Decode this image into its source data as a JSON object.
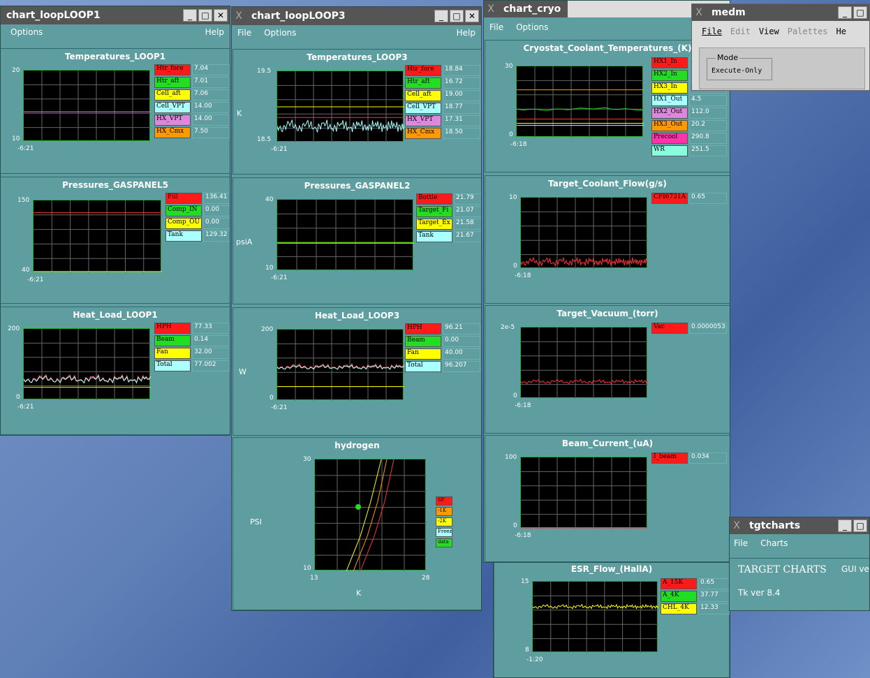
{
  "windows": {
    "loop1": {
      "title": "chart_loopLOOP1",
      "menu": [
        "Options",
        "Help"
      ]
    },
    "loop3": {
      "title": "chart_loopLOOP3",
      "menu": [
        "File",
        "Options",
        "Help"
      ]
    },
    "cryo": {
      "title": "chart_cryo",
      "menu": [
        "File",
        "Options"
      ]
    },
    "medm": {
      "title": "medm",
      "menu": [
        "File",
        "Edit",
        "View",
        "Palettes",
        "He"
      ],
      "mode_label": "Mode",
      "mode_value": "Execute-Only"
    },
    "tgt": {
      "title": "tgtcharts",
      "menu": [
        "File",
        "Charts"
      ],
      "heading": "TARGET CHARTS",
      "gui": "GUI ve",
      "tk": "Tk ver 8.4"
    }
  },
  "panels": {
    "t_loop1": {
      "title": "Temperatures_LOOP1",
      "ymax": "20",
      "ymin": "10",
      "time": "-6:21",
      "unit": "",
      "legend": [
        [
          "Htr_fore",
          "7.04",
          "#ff1a1a"
        ],
        [
          "Htr_aft",
          "7.01",
          "#22dd22"
        ],
        [
          "Cell_aft",
          "7.06",
          "#ffff00"
        ],
        [
          "Cell_VPT",
          "14.00",
          "#aaffff"
        ],
        [
          "HX_VPT",
          "14.00",
          "#dd88dd"
        ],
        [
          "HX_Cmx",
          "7.50",
          "#ff9900"
        ]
      ]
    },
    "p_gas5": {
      "title": "Pressures_GASPANEL5",
      "ymax": "150",
      "ymin": "40",
      "time": "-6:21",
      "unit": "",
      "legend": [
        [
          "Fill",
          "136.41",
          "#ff1a1a"
        ],
        [
          "Comp_IN",
          "0.00",
          "#22dd22"
        ],
        [
          "Comp_OU",
          "0.00",
          "#ffff00"
        ],
        [
          "Tank",
          "129.32",
          "#aaffff"
        ]
      ]
    },
    "h_loop1": {
      "title": "Heat_Load_LOOP1",
      "ymax": "200",
      "ymin": "0",
      "time": "-6:21",
      "unit": "",
      "legend": [
        [
          "HPH",
          "77.33",
          "#ff1a1a"
        ],
        [
          "Beam",
          "0.14",
          "#22dd22"
        ],
        [
          "Fan",
          "32.00",
          "#ffff00"
        ],
        [
          "Total",
          "77.002",
          "#aaffff"
        ]
      ]
    },
    "t_loop3": {
      "title": "Temperatures_LOOP3",
      "ymax": "19.5",
      "ymin": "18.5",
      "time": "-6:21",
      "unit": "K",
      "legend": [
        [
          "Htr_fore",
          "18.84",
          "#ff1a1a"
        ],
        [
          "Htr_aft",
          "16.72",
          "#22dd22"
        ],
        [
          "Cell_aft",
          "19.00",
          "#ffff00"
        ],
        [
          "Cell_VPT",
          "18.77",
          "#aaffff"
        ],
        [
          "HX_VPT",
          "17.31",
          "#dd88dd"
        ],
        [
          "HX_Cmx",
          "18.50",
          "#ff9900"
        ]
      ]
    },
    "p_gas2": {
      "title": "Pressures_GASPANEL2",
      "ymax": "40",
      "ymin": "10",
      "time": "-6:21",
      "unit": "psiA",
      "legend": [
        [
          "Bottle",
          "21.79",
          "#ff1a1a"
        ],
        [
          "Target_Fi",
          "21.07",
          "#22dd22"
        ],
        [
          "Target_Ex",
          "21.58",
          "#ffff00"
        ],
        [
          "Tank",
          "21.67",
          "#aaffff"
        ]
      ]
    },
    "h_loop3": {
      "title": "Heat_Load_LOOP3",
      "ymax": "200",
      "ymin": "0",
      "time": "-6:21",
      "unit": "W",
      "legend": [
        [
          "HPH",
          "96.21",
          "#ff1a1a"
        ],
        [
          "Beam",
          "0.00",
          "#22dd22"
        ],
        [
          "Fan",
          "40.00",
          "#ffff00"
        ],
        [
          "Total",
          "96.207",
          "#aaffff"
        ]
      ]
    },
    "hydrogen": {
      "title": "hydrogen",
      "ymax": "30",
      "ymin": "10",
      "xmin": "13",
      "xmax": "28",
      "unit": "PSI",
      "xunit": "K",
      "legend": [
        [
          "SP",
          "#ff1a1a"
        ],
        [
          "-1K",
          "#ff9900"
        ],
        [
          "-2K",
          "#ffff00"
        ],
        [
          "Freez",
          "#aaffff"
        ],
        [
          "data",
          "#22dd22"
        ]
      ]
    },
    "cryo_t": {
      "title": "Cryostat_Coolant_Temperatures_(K)",
      "ymax": "30",
      "ymin": "0",
      "time": "-6:18",
      "unit": "",
      "legend": [
        [
          "HX1_In",
          "",
          "#ff1a1a"
        ],
        [
          "HX2_In",
          "",
          "#22dd22"
        ],
        [
          "HX3_In",
          "",
          "#ffff00"
        ],
        [
          "HX1_Out",
          "4.5",
          "#aaffff"
        ],
        [
          "HX2_Out",
          "112.0",
          "#dd88dd"
        ],
        [
          "HX3_Out",
          "20.2",
          "#ff9900"
        ],
        [
          "Precool",
          "290.8",
          "#ff33aa"
        ],
        [
          "WR",
          "251.5",
          "#88ffdd"
        ]
      ]
    },
    "flow": {
      "title": "Target_Coolant_Flow(g/s)",
      "ymax": "10",
      "ymin": "0",
      "time": "-6:18",
      "unit": "",
      "legend": [
        [
          "CFI6731A",
          "0.65",
          "#ff1a1a"
        ]
      ]
    },
    "vac": {
      "title": "Target_Vacuum_(torr)",
      "ymax": "2e-5",
      "ymin": "0",
      "time": "-6:18",
      "unit": "",
      "legend": [
        [
          "Vac",
          "0.0000053",
          "#ff1a1a"
        ]
      ]
    },
    "beam": {
      "title": "Beam_Current_(uA)",
      "ymax": "100",
      "ymin": "0",
      "time": "-6:18",
      "unit": "",
      "legend": [
        [
          "I_beam",
          "0.034",
          "#ff1a1a"
        ]
      ]
    },
    "esr": {
      "title": "ESR_Flow_(HallA)",
      "ymax": "15",
      "ymin": "8",
      "time": "-1:20",
      "unit": "",
      "legend": [
        [
          "A_15K",
          "0.65",
          "#ff1a1a"
        ],
        [
          "A_4K",
          "37.77",
          "#22dd22"
        ],
        [
          "CHL_4K",
          "12.33",
          "#ffff00"
        ]
      ]
    }
  }
}
